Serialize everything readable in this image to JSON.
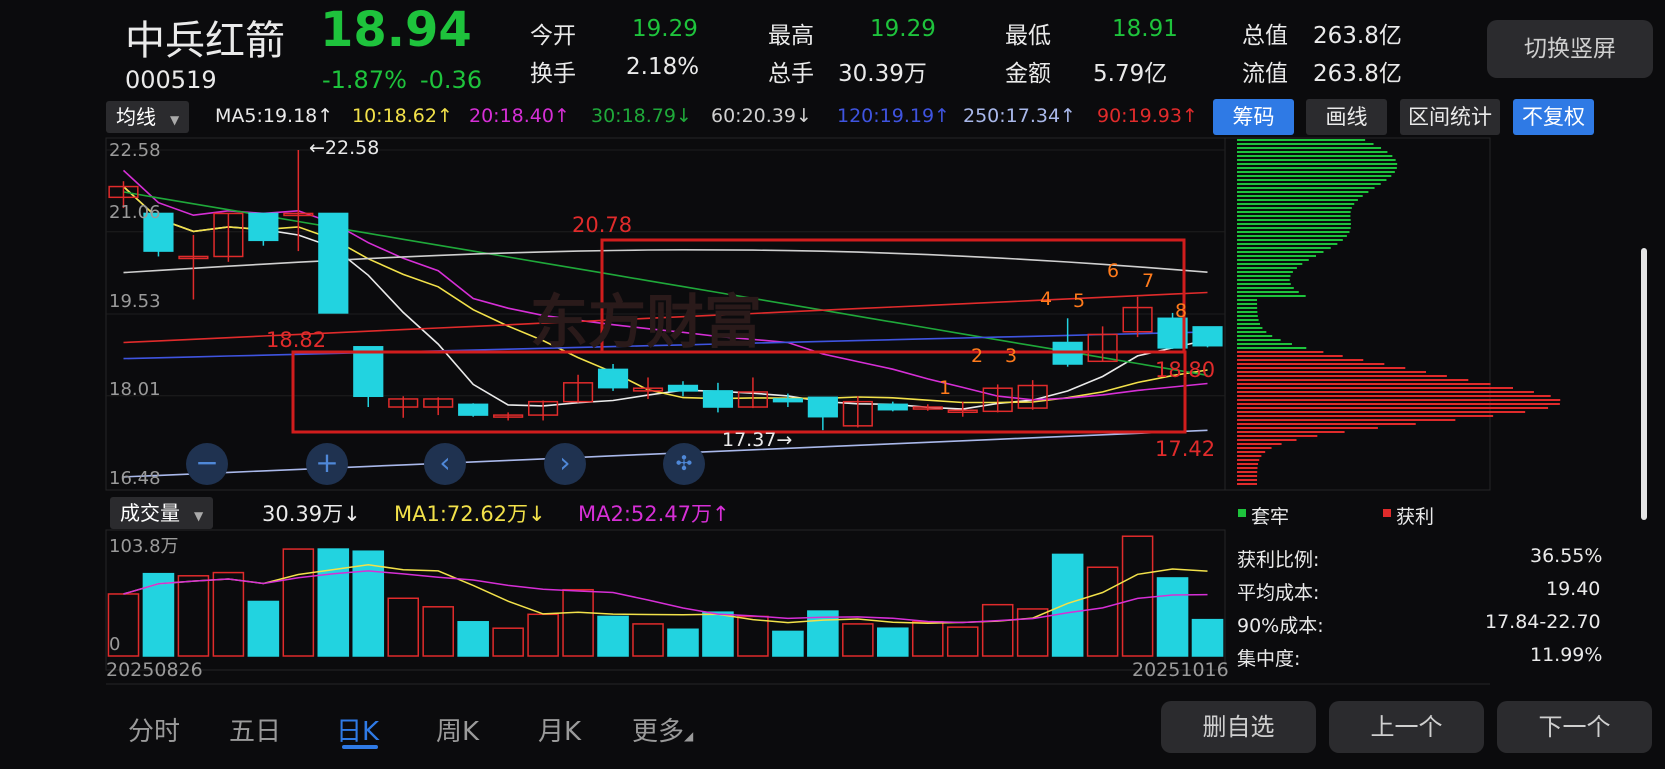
{
  "stock": {
    "name": "中兵红箭",
    "code": "000519",
    "price": "18.94",
    "change_pct": "-1.87%",
    "change_abs": "-0.36"
  },
  "quote": {
    "open_label": "今开",
    "open": "19.29",
    "high_label": "最高",
    "high": "19.29",
    "low_label": "最低",
    "low": "18.91",
    "total_cap_label": "总值",
    "total_cap": "263.8亿",
    "turnover_label": "换手",
    "turnover": "2.18%",
    "volume_label": "总手",
    "volume": "30.39万",
    "amount_label": "金额",
    "amount": "5.79亿",
    "float_cap_label": "流值",
    "float_cap": "263.8亿"
  },
  "switch_button": "切换竖屏",
  "ma_bar": {
    "selector": "均线",
    "items": [
      {
        "text": "MA5:19.18↑",
        "color": "#eaeaea"
      },
      {
        "text": "10:18.62↑",
        "color": "#f2e14a"
      },
      {
        "text": "20:18.40↑",
        "color": "#d62fd6"
      },
      {
        "text": "30:18.79↓",
        "color": "#1fa83a"
      },
      {
        "text": "60:20.39↓",
        "color": "#cfcfcf"
      },
      {
        "text": "120:19.19↑",
        "color": "#3f54e0"
      },
      {
        "text": "250:17.34↑",
        "color": "#a9b8ea"
      },
      {
        "text": "90:19.93↑",
        "color": "#e02b2b"
      }
    ],
    "buttons": [
      "筹码",
      "画线",
      "区间统计",
      "不复权"
    ]
  },
  "price_axis": [
    "22.58",
    "21.06",
    "19.53",
    "18.01",
    "16.48"
  ],
  "chart_labels": {
    "high_marker": "←22.58",
    "low_marker": "17.37→",
    "red_label_1": "20.78",
    "red_label_2": "18.82",
    "red_label_3": "18.80",
    "red_label_4": "17.42",
    "watermark": "东方财富",
    "counts": [
      "1",
      "2",
      "3",
      "4",
      "5",
      "6",
      "7",
      "8"
    ]
  },
  "chart_data": {
    "type": "candlestick",
    "x_start": "20250826",
    "x_end": "20251016",
    "ylim": [
      16.48,
      22.58
    ],
    "candles": [
      [
        21.7,
        21.9,
        21.5,
        22.0
      ],
      [
        21.4,
        20.7,
        20.6,
        21.4
      ],
      [
        20.6,
        20.6,
        19.8,
        21.0
      ],
      [
        20.6,
        21.4,
        20.5,
        21.4
      ],
      [
        21.4,
        20.9,
        20.8,
        21.4
      ],
      [
        21.4,
        21.4,
        20.7,
        22.58
      ],
      [
        21.4,
        19.55,
        19.55,
        21.4
      ],
      [
        18.92,
        18.0,
        17.8,
        18.92
      ],
      [
        17.8,
        17.95,
        17.6,
        18.0
      ],
      [
        17.8,
        17.95,
        17.65,
        17.98
      ],
      [
        17.85,
        17.65,
        17.62,
        17.87
      ],
      [
        17.65,
        17.65,
        17.55,
        17.7
      ],
      [
        17.65,
        17.9,
        17.55,
        17.92
      ],
      [
        17.9,
        18.25,
        17.88,
        18.4
      ],
      [
        18.5,
        18.16,
        18.1,
        18.6
      ],
      [
        18.1,
        18.15,
        17.95,
        18.35
      ],
      [
        18.2,
        18.1,
        18.0,
        18.28
      ],
      [
        18.1,
        17.8,
        17.7,
        18.25
      ],
      [
        17.8,
        18.08,
        17.78,
        18.35
      ],
      [
        17.95,
        17.9,
        17.8,
        18.05
      ],
      [
        17.98,
        17.62,
        17.37,
        17.98
      ],
      [
        17.45,
        17.9,
        17.42,
        18.0
      ],
      [
        17.85,
        17.75,
        17.72,
        17.9
      ],
      [
        17.78,
        17.8,
        17.73,
        17.85
      ],
      [
        17.72,
        17.74,
        17.62,
        17.9
      ],
      [
        17.72,
        18.15,
        17.7,
        18.22
      ],
      [
        17.78,
        18.2,
        17.75,
        18.3
      ],
      [
        19.0,
        18.6,
        18.55,
        19.45
      ],
      [
        18.65,
        19.15,
        18.65,
        19.3
      ],
      [
        19.2,
        19.65,
        19.1,
        19.85
      ],
      [
        19.45,
        18.9,
        18.88,
        19.55
      ],
      [
        19.29,
        18.94,
        18.91,
        19.29
      ]
    ],
    "volume": {
      "max_label": "103.8万",
      "zero_label": "0",
      "title": "成交量",
      "current": "30.39万↓",
      "ma1": "MA1:72.62万↓",
      "ma2": "MA2:52.47万↑",
      "bars": [
        58,
        77,
        75,
        78,
        51,
        100,
        100,
        98,
        54,
        46,
        32,
        26,
        39,
        62,
        37,
        30,
        25,
        41,
        37,
        23,
        42,
        30,
        26,
        32,
        27,
        48,
        44,
        95,
        83,
        112,
        73,
        34
      ]
    }
  },
  "chips": {
    "legend_trapped": "套牢",
    "legend_profit": "获利",
    "stats": [
      {
        "label": "获利比例:",
        "value": "36.55%"
      },
      {
        "label": "平均成本:",
        "value": "19.40"
      },
      {
        "label": "90%成本:",
        "value": "17.84-22.70"
      },
      {
        "label": "集中度:",
        "value": "11.99%"
      }
    ]
  },
  "tabs": [
    "分时",
    "五日",
    "日K",
    "周K",
    "月K",
    "更多"
  ],
  "bottom_buttons": [
    "删自选",
    "上一个",
    "下一个"
  ],
  "colors": {
    "up": "#e02b2b",
    "down": "#22d3e0",
    "green": "#1ec33c",
    "accent": "#2f7ae5"
  }
}
